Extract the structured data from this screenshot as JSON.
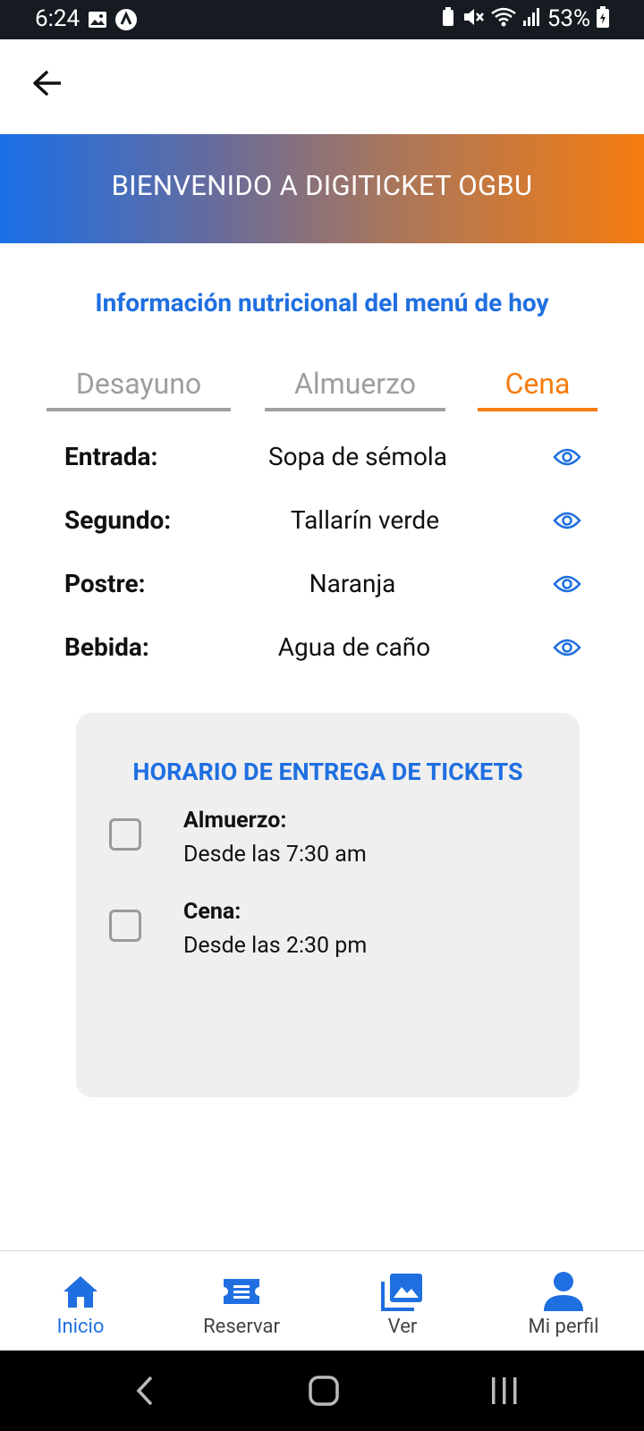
{
  "status_bar": {
    "time": "6:24",
    "battery": "53%"
  },
  "banner": {
    "title": "BIENVENIDO A DIGITICKET OGBU"
  },
  "section": {
    "title": "Información nutricional del menú de hoy"
  },
  "tabs": [
    {
      "label": "Desayuno",
      "active": false
    },
    {
      "label": "Almuerzo",
      "active": false
    },
    {
      "label": "Cena",
      "active": true
    }
  ],
  "menu": [
    {
      "label": "Entrada:",
      "value": "Sopa de sémola"
    },
    {
      "label": "Segundo:",
      "value": "Tallarín verde"
    },
    {
      "label": "Postre:",
      "value": "Naranja"
    },
    {
      "label": "Bebida:",
      "value": "Agua de caño"
    }
  ],
  "schedule": {
    "title": "HORARIO DE ENTREGA DE TICKETS",
    "items": [
      {
        "name": "Almuerzo:",
        "time": "Desde las 7:30 am",
        "checked": false
      },
      {
        "name": "Cena:",
        "time": "Desde las 2:30 pm",
        "checked": false
      }
    ]
  },
  "bottom_nav": [
    {
      "label": "Inicio",
      "icon": "home-icon",
      "active": true
    },
    {
      "label": "Reservar",
      "icon": "ticket-icon",
      "active": false
    },
    {
      "label": "Ver",
      "icon": "gallery-icon",
      "active": false
    },
    {
      "label": "Mi perfil",
      "icon": "person-icon",
      "active": false
    }
  ],
  "colors": {
    "primary_blue": "#1f6fe0",
    "accent_orange": "#f57c10",
    "inactive_gray": "#9e9e9e",
    "card_bg": "#efefef"
  }
}
